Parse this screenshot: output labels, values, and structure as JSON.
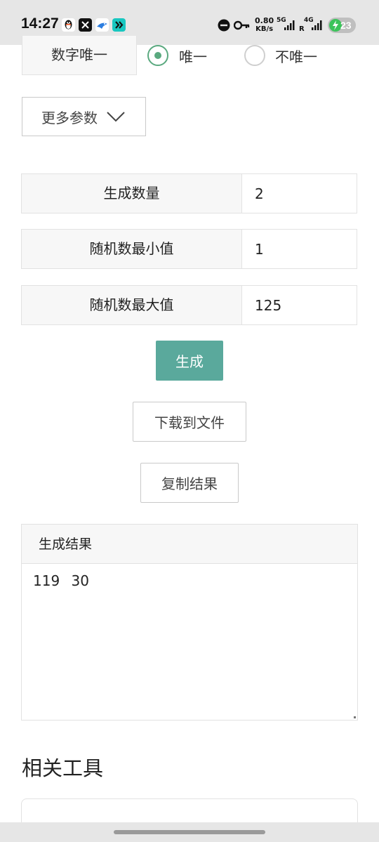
{
  "status_bar": {
    "time": "14:27",
    "net_speed_value": "0.80",
    "net_speed_unit": "KB/s",
    "sig1": "5G",
    "sig2": "4G",
    "roaming": "R",
    "battery": "23",
    "apps": [
      "qq-icon",
      "x-icon",
      "bird-app-icon",
      "forward-app-icon"
    ]
  },
  "unique": {
    "label": "数字唯一",
    "option_unique": "唯一",
    "option_not_unique": "不唯一",
    "selected": "唯一"
  },
  "more_params_label": "更多参数",
  "params": [
    {
      "label": "生成数量",
      "value": "2"
    },
    {
      "label": "随机数最小值",
      "value": "1"
    },
    {
      "label": "随机数最大值",
      "value": "125"
    }
  ],
  "buttons": {
    "generate": "生成",
    "download": "下载到文件",
    "copy": "复制结果"
  },
  "result": {
    "title": "生成结果",
    "text": "119 30"
  },
  "related_title": "相关工具",
  "colors": {
    "accent": "#5aa99c",
    "radio_selected": "#5aa97f",
    "battery_charging": "#3cc35a"
  }
}
